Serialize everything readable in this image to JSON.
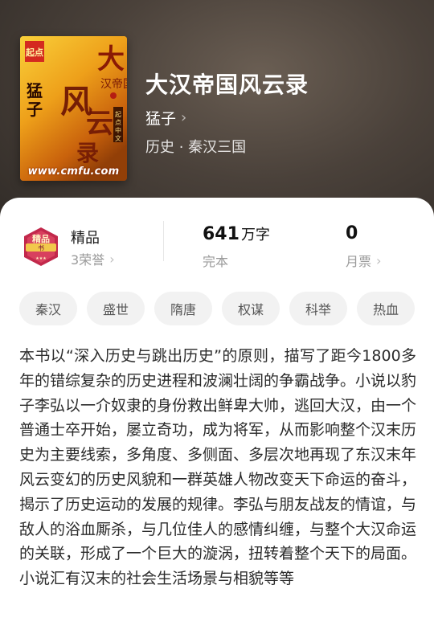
{
  "book": {
    "title": "大汉帝国风云录",
    "author": "猛子",
    "genre": "历史 · 秦汉三国",
    "cover": {
      "url_text": "www.cmfu.com",
      "lettering": "大汉帝国风云录 猛子 起点中文"
    }
  },
  "badge": {
    "label": "精品",
    "sub": "3荣誉",
    "emblem_text": "精品书",
    "colors": {
      "primary": "#c2284b",
      "accent": "#f2c84b"
    }
  },
  "stats": {
    "words_value": "641",
    "words_unit": "万字",
    "words_status": "完本",
    "ticket_value": "0",
    "ticket_label": "月票"
  },
  "tags": [
    "秦汉",
    "盛世",
    "隋唐",
    "权谋",
    "科举",
    "热血"
  ],
  "description": "本书以“深入历史与跳出历史”的原则，描写了距今1800多年的错综复杂的历史进程和波澜壮阔的争霸战争。小说以豹子李弘以一介奴隶的身份救出鲜卑大帅，逃回大汉，由一个普通士卒开始，屡立奇功，成为将军，从而影响整个汉末历史为主要线索，多角度、多侧面、多层次地再现了东汉末年风云变幻的历史风貌和一群英雄人物改变天下命运的奋斗，揭示了历史运动的发展的规律。李弘与朋友战友的情谊，与敌人的浴血厮杀，与几位佳人的感情纠缠，与整个大汉命运的关联，形成了一个巨大的漩涡，扭转着整个天下的局面。小说汇有汉末的社会生活场景与相貌等等",
  "icons": {
    "chevron": "chevron-right-icon"
  }
}
